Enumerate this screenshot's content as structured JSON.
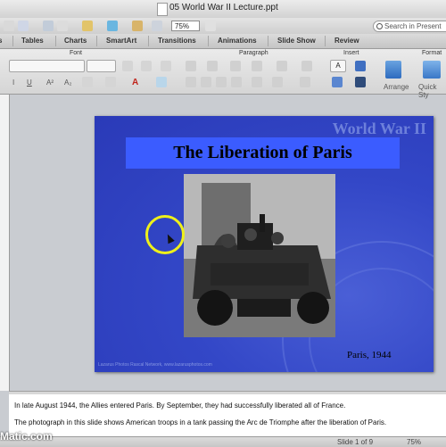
{
  "window": {
    "title": "05 World War II Lecture.ppt"
  },
  "toolbar": {
    "zoom": "75%",
    "search_placeholder": "Search in Present"
  },
  "tabs": [
    "Tables",
    "Charts",
    "SmartArt",
    "Transitions",
    "Animations",
    "Slide Show",
    "Review"
  ],
  "ribbon": {
    "groups": {
      "font": "Font",
      "paragraph": "Paragraph",
      "insert": "Insert",
      "format": "Format"
    },
    "arrange_label": "Arrange",
    "quick_styles_label": "Quick Sty"
  },
  "slide": {
    "watermark": "World War II",
    "title": "The Liberation of Paris",
    "caption": "Paris, 1944",
    "credit": "Lazarus Photos Rascal Network, www.lazarusphotos.com",
    "colors": {
      "background": "#3347c7",
      "title_bar": "#3b5cff"
    }
  },
  "notes": [
    "In late August 1944, the Allies entered Paris. By September, they had successfully liberated all of France.",
    "The photograph in this slide shows American troops in a tank passing the Arc de Triomphe after the liberation of Paris."
  ],
  "status": {
    "slide_position": "Slide 1 of 9",
    "zoom": "75%"
  },
  "brand": "Matic.com",
  "icons": [
    "document-icon",
    "undo-icon",
    "redo-icon",
    "search-icon",
    "arrange-icon",
    "quick-styles-icon",
    "photo-tank"
  ]
}
